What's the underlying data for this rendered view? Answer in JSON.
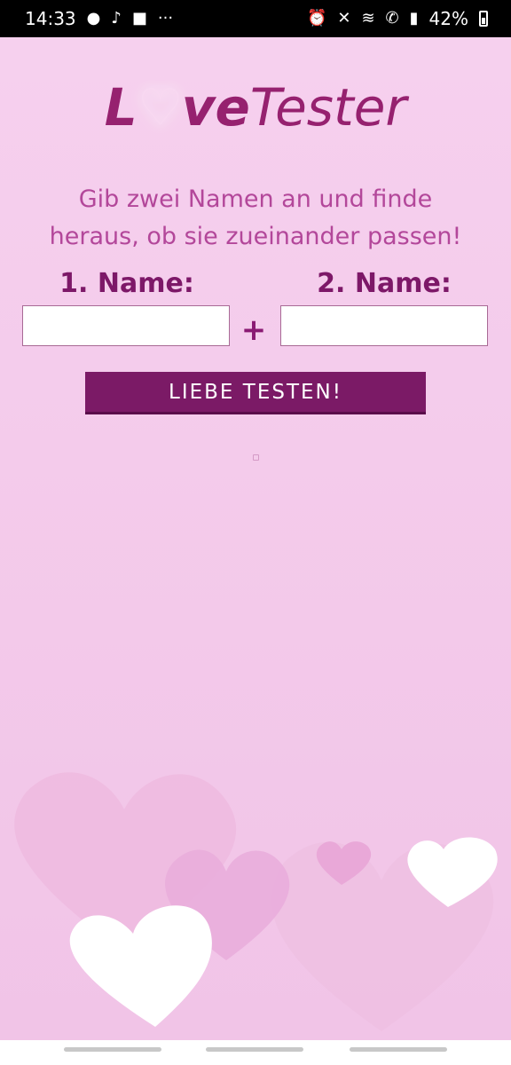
{
  "status_bar": {
    "time": "14:33",
    "left_icons": [
      "notification-icon",
      "tiktok-icon",
      "video-icon",
      "more-icon"
    ],
    "right_icons": [
      "alarm-icon",
      "mute-icon",
      "wifi-icon",
      "wifi-call-icon",
      "signal-icon"
    ],
    "battery": "42%"
  },
  "app": {
    "logo_love_prefix": "L",
    "logo_love_suffix": "ve",
    "logo_tester": "Tester",
    "intro": "Gib zwei Namen an und finde heraus, ob sie zueinander passen!",
    "name1_label": "1. Name:",
    "name2_label": "2. Name:",
    "name1_value": "",
    "name2_value": "",
    "plus": "+",
    "submit_label": "LIEBE TESTEN!"
  },
  "colors": {
    "background": "#f4cdec",
    "brand": "#96216f",
    "button": "#7b1a66",
    "intro_text": "#b3479a"
  }
}
